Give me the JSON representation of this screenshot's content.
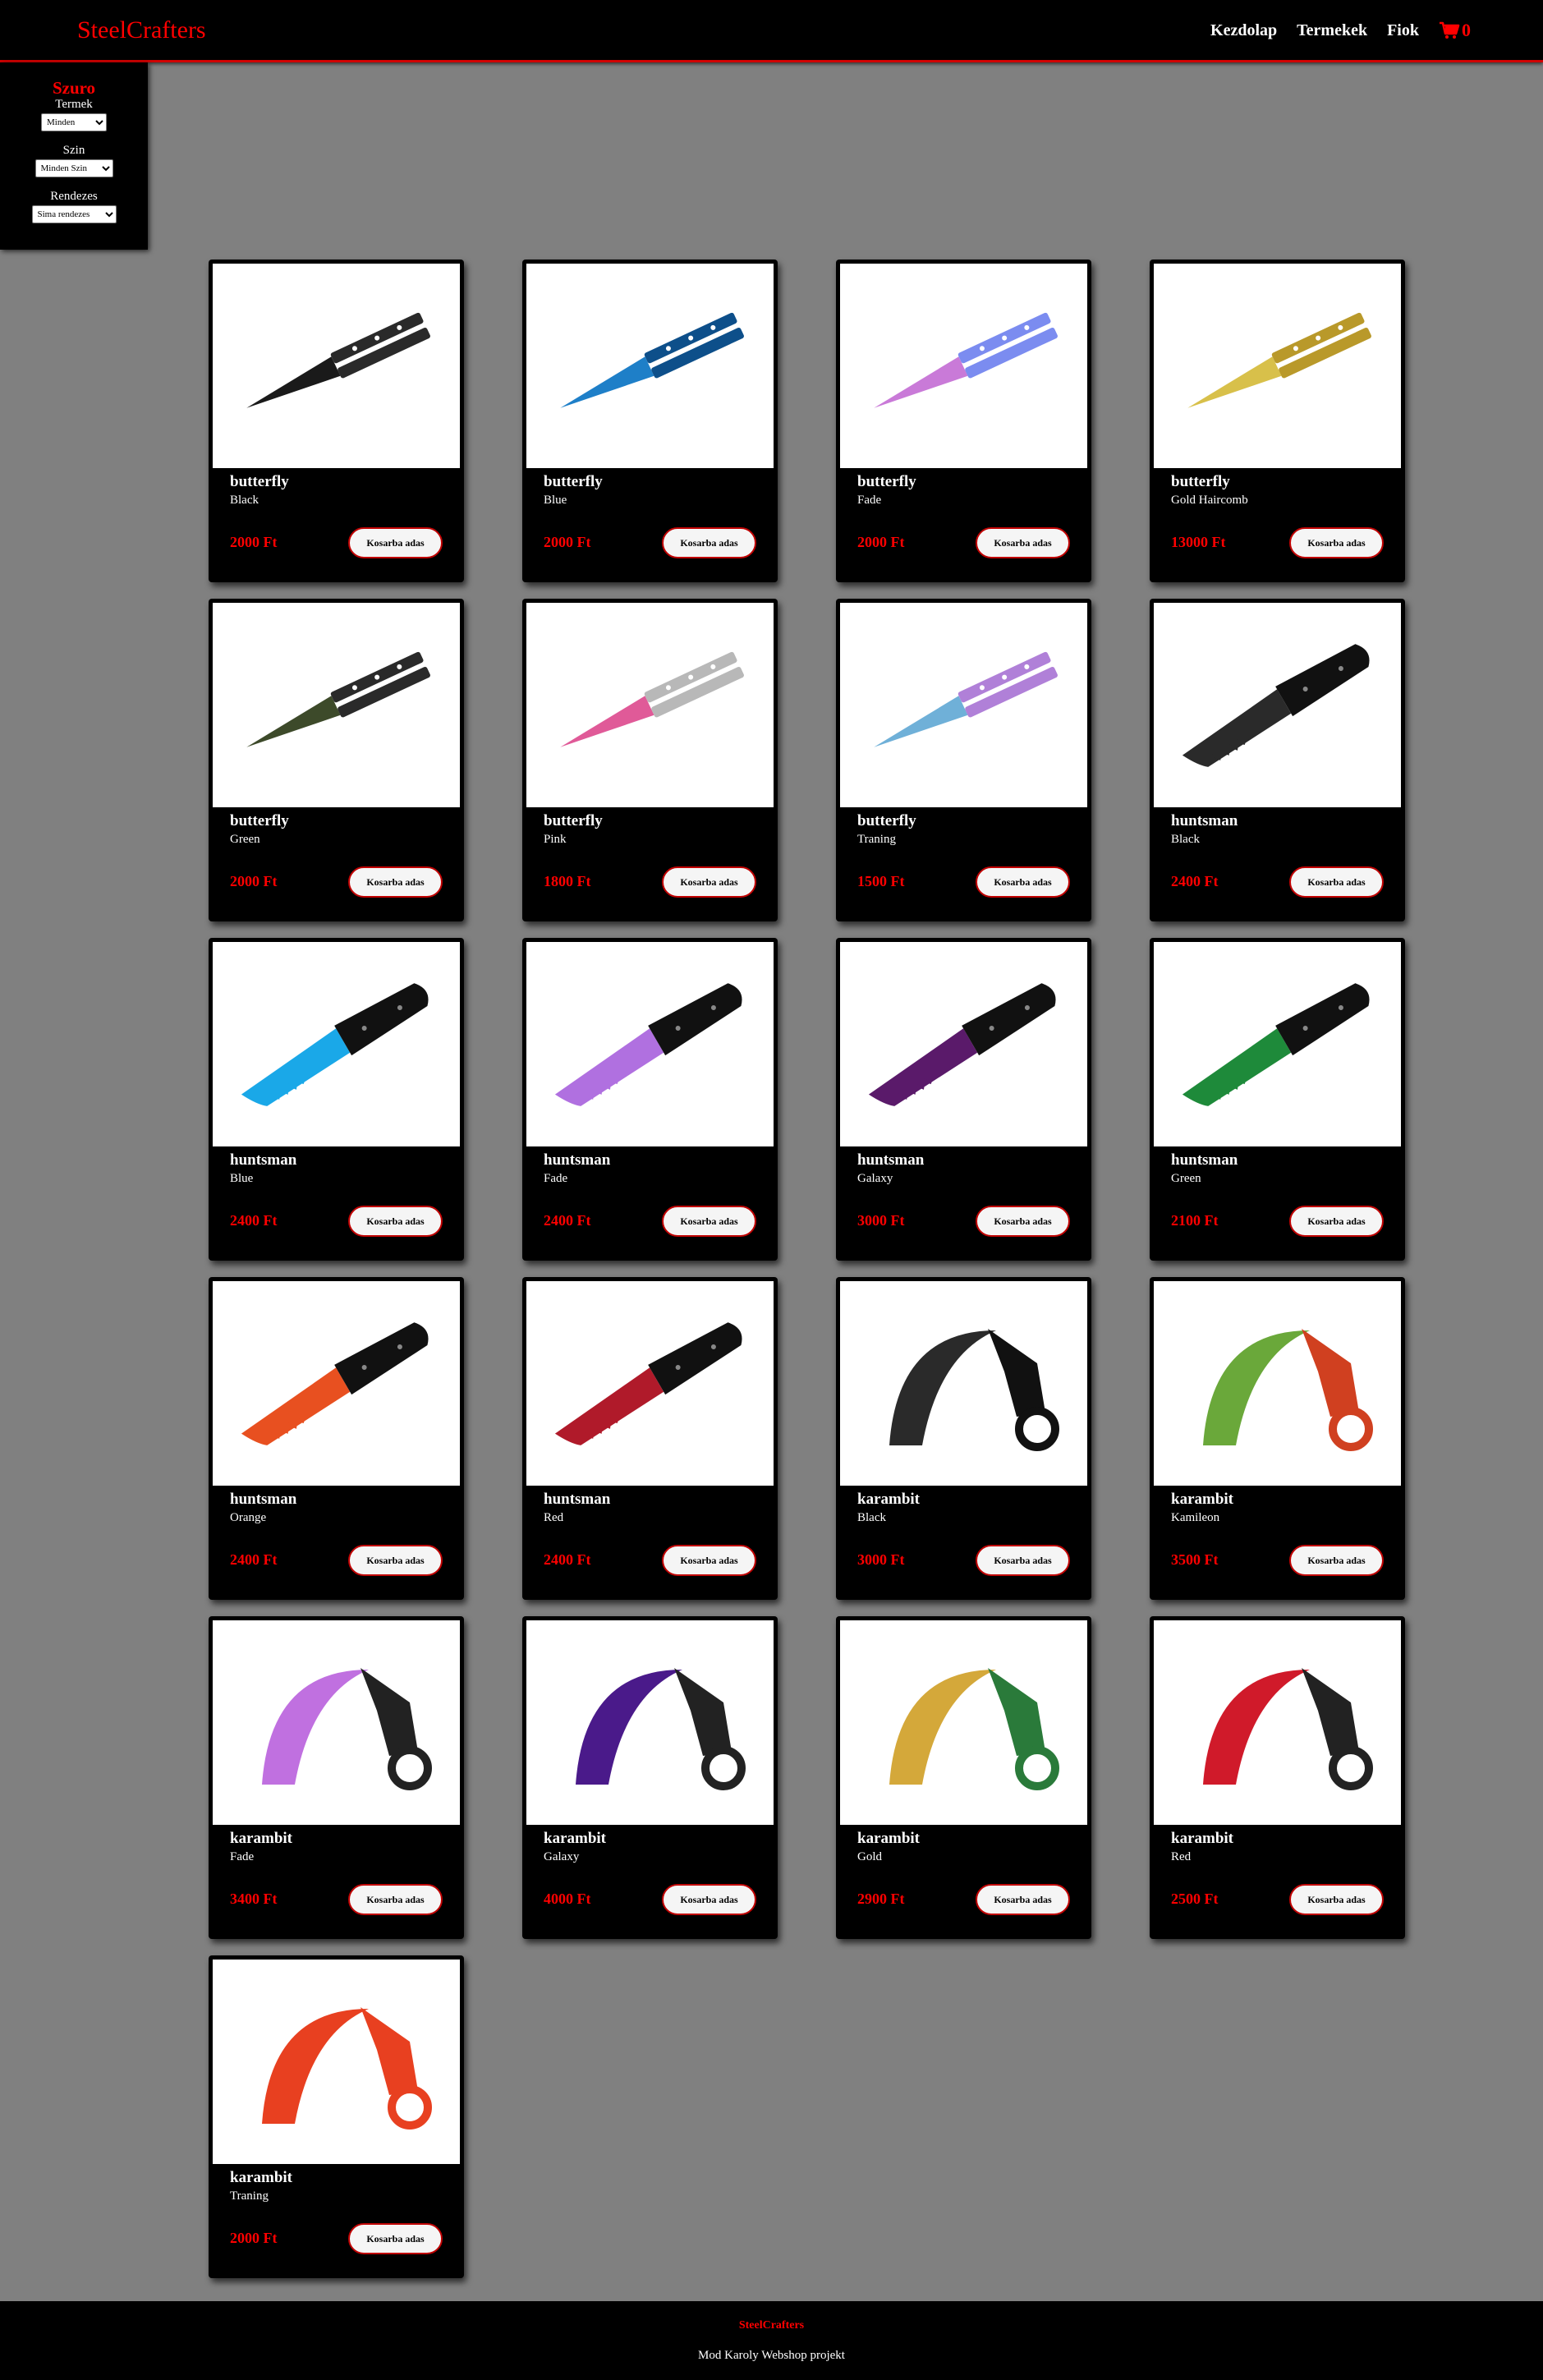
{
  "header": {
    "brand": "SteelCrafters",
    "nav": [
      "Kezdolap",
      "Termekek",
      "Fiok"
    ],
    "cart_count": "0",
    "cart_icon": "shopping-cart-icon"
  },
  "filter": {
    "title": "Szuro",
    "termek_label": "Termek",
    "termek_value": "Minden",
    "szin_label": "Szin",
    "szin_value": "Minden Szin",
    "rendezes_label": "Rendezes",
    "rendezes_value": "Sima rendezes"
  },
  "add_to_cart_label": "Kosarba adas",
  "products": [
    {
      "name": "butterfly",
      "variant": "Black",
      "price": "2000 Ft",
      "image": "butterfly-knife-black",
      "colors": [
        "#1a1a1a",
        "#2a2a2a"
      ]
    },
    {
      "name": "butterfly",
      "variant": "Blue",
      "price": "2000 Ft",
      "image": "butterfly-knife-blue",
      "colors": [
        "#1e7fc8",
        "#0d4f8a"
      ]
    },
    {
      "name": "butterfly",
      "variant": "Fade",
      "price": "2000 Ft",
      "image": "butterfly-knife-fade",
      "colors": [
        "#c97ad8",
        "#7b8cf0"
      ]
    },
    {
      "name": "butterfly",
      "variant": "Gold Haircomb",
      "price": "13000 Ft",
      "image": "butterfly-comb-gold",
      "colors": [
        "#d8c04a",
        "#b9992a"
      ]
    },
    {
      "name": "butterfly",
      "variant": "Green",
      "price": "2000 Ft",
      "image": "butterfly-knife-green",
      "colors": [
        "#3d4a2a",
        "#2a2a2a"
      ]
    },
    {
      "name": "butterfly",
      "variant": "Pink",
      "price": "1800 Ft",
      "image": "butterfly-knife-pink",
      "colors": [
        "#e05a98",
        "#b8b8b8"
      ]
    },
    {
      "name": "butterfly",
      "variant": "Traning",
      "price": "1500 Ft",
      "image": "butterfly-knife-training",
      "colors": [
        "#6fb0d8",
        "#b080d8"
      ]
    },
    {
      "name": "huntsman",
      "variant": "Black",
      "price": "2400 Ft",
      "image": "huntsman-knife-black",
      "colors": [
        "#2a2a2a",
        "#111111"
      ]
    },
    {
      "name": "huntsman",
      "variant": "Blue",
      "price": "2400 Ft",
      "image": "huntsman-knife-blue",
      "colors": [
        "#1aa8e8",
        "#111111"
      ]
    },
    {
      "name": "huntsman",
      "variant": "Fade",
      "price": "2400 Ft",
      "image": "huntsman-knife-fade",
      "colors": [
        "#b070e0",
        "#111111"
      ]
    },
    {
      "name": "huntsman",
      "variant": "Galaxy",
      "price": "3000 Ft",
      "image": "huntsman-knife-galaxy",
      "colors": [
        "#5a1a6a",
        "#111111"
      ]
    },
    {
      "name": "huntsman",
      "variant": "Green",
      "price": "2100 Ft",
      "image": "huntsman-knife-green",
      "colors": [
        "#1e8a3a",
        "#111111"
      ]
    },
    {
      "name": "huntsman",
      "variant": "Orange",
      "price": "2400 Ft",
      "image": "huntsman-knife-orange",
      "colors": [
        "#e85020",
        "#111111"
      ]
    },
    {
      "name": "huntsman",
      "variant": "Red",
      "price": "2400 Ft",
      "image": "huntsman-knife-red",
      "colors": [
        "#b01a2a",
        "#111111"
      ]
    },
    {
      "name": "karambit",
      "variant": "Black",
      "price": "3000 Ft",
      "image": "karambit-knife-black",
      "colors": [
        "#2a2a2a",
        "#111111"
      ]
    },
    {
      "name": "karambit",
      "variant": "Kamileon",
      "price": "3500 Ft",
      "image": "karambit-knife-chameleon",
      "colors": [
        "#6aa83a",
        "#d04020"
      ]
    },
    {
      "name": "karambit",
      "variant": "Fade",
      "price": "3400 Ft",
      "image": "karambit-knife-fade",
      "colors": [
        "#c070e0",
        "#222222"
      ]
    },
    {
      "name": "karambit",
      "variant": "Galaxy",
      "price": "4000 Ft",
      "image": "karambit-knife-galaxy",
      "colors": [
        "#4a1a8a",
        "#222222"
      ]
    },
    {
      "name": "karambit",
      "variant": "Gold",
      "price": "2900 Ft",
      "image": "karambit-knife-gold",
      "colors": [
        "#d4a83a",
        "#2a7a3a"
      ]
    },
    {
      "name": "karambit",
      "variant": "Red",
      "price": "2500 Ft",
      "image": "karambit-knife-red",
      "colors": [
        "#d01a2a",
        "#222222"
      ]
    },
    {
      "name": "karambit",
      "variant": "Traning",
      "price": "2000 Ft",
      "image": "karambit-knife-training",
      "colors": [
        "#e84020",
        "#e84020"
      ]
    }
  ],
  "footer": {
    "brand": "SteelCrafters",
    "text": "Mod Karoly Webshop projekt"
  }
}
